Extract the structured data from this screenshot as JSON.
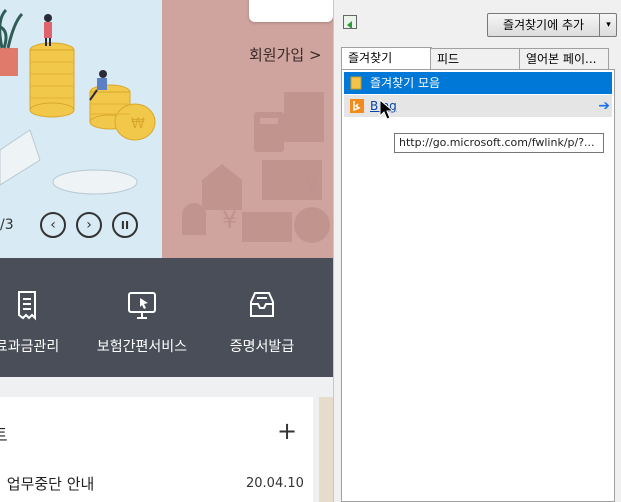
{
  "webpage": {
    "join_link": "회원가입 >",
    "slide_counter": "/3",
    "slide_controls": {
      "prev": "‹",
      "next": "›",
      "pause": "II"
    },
    "services": [
      {
        "label": "료과금관리",
        "icon": "receipt-icon"
      },
      {
        "label": "보험간편서비스",
        "icon": "monitor-pointer-icon"
      },
      {
        "label": "증명서발급",
        "icon": "inbox-icon"
      }
    ],
    "notice": {
      "title": "트",
      "plus": "+",
      "item_text": "! 업무중단 안내",
      "item_date": "20.04.10"
    }
  },
  "favorites_pane": {
    "add_button_label": "즐겨찾기에 추가",
    "add_button_arrow": "▾",
    "tabs": [
      "즐겨찾기",
      "피드",
      "열어본 페이..."
    ],
    "items": [
      {
        "label": "즐겨찾기 모음",
        "icon": "folder-icon",
        "selected": true
      },
      {
        "label": "Bing",
        "icon": "bing-icon",
        "selected": false,
        "arrow": "➔"
      }
    ],
    "tooltip": "http://go.microsoft.com/fwlink/p/?..."
  },
  "colors": {
    "hero_left_bg": "#d8eaf3",
    "hero_right_bg": "#cfa49f",
    "service_bar_bg": "#494e58",
    "selection_blue": "#0078d7"
  }
}
